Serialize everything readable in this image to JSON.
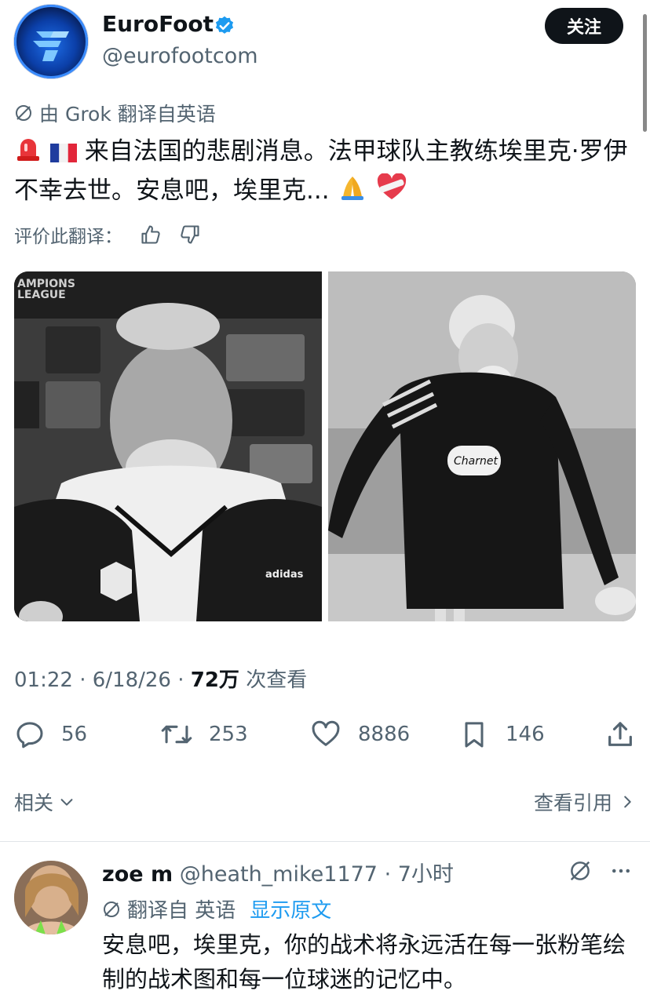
{
  "header": {
    "display_name": "EuroFoot",
    "handle": "@eurofootcom",
    "follow_label": "关注",
    "avatar_icon": "eurofoot-logo"
  },
  "translation": {
    "notice": "由 Grok 翻译自英语",
    "text": "来自法国的悲剧消息。法甲球队主教练埃里克·罗伊不幸去世。安息吧，埃里克...",
    "rate_label": "评价此翻译："
  },
  "photos": [
    {
      "icon": "coach-press-conference-photo"
    },
    {
      "icon": "coach-training-photo"
    }
  ],
  "meta": {
    "time": "01:22 · 6/18/26 · ",
    "views": "72万",
    "views_suffix": " 次查看"
  },
  "actions": {
    "replies": "56",
    "retweets": "253",
    "likes": "8886",
    "bookmarks": "146"
  },
  "related": {
    "label": "相关",
    "quotes_label": "查看引用"
  },
  "reply": {
    "name": "zoe m",
    "handle": "@heath_mike1177",
    "time": "· 7小时",
    "translated_from": "翻译自 英语",
    "show_original": "显示原文",
    "text": "安息吧，埃里克，你的战术将永远活在每一张粉笔绘制的战术图和每一位球迷的记忆中。"
  },
  "colors": {
    "text": "#0f1419",
    "muted": "#536471",
    "link": "#1d9bf0",
    "verified": "#1d9bf0"
  }
}
